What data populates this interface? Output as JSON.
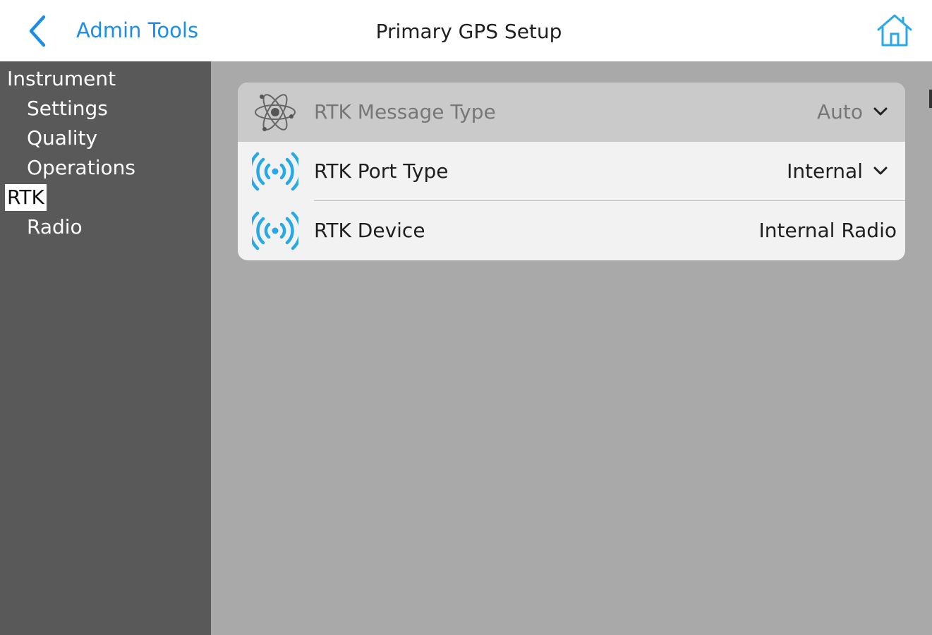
{
  "header": {
    "back_label": "Admin Tools",
    "title": "Primary GPS Setup",
    "back_icon": "chevron-left-icon",
    "home_icon": "home-icon"
  },
  "sidebar": {
    "items": [
      {
        "label": "Instrument",
        "level": 0,
        "selected": false
      },
      {
        "label": "Settings",
        "level": 1,
        "selected": false
      },
      {
        "label": "Quality",
        "level": 1,
        "selected": false
      },
      {
        "label": "Operations",
        "level": 1,
        "selected": false
      },
      {
        "label": "RTK",
        "level": 0,
        "selected": true
      },
      {
        "label": "Radio",
        "level": 1,
        "selected": false
      }
    ]
  },
  "settings": {
    "rows": [
      {
        "label": "RTK Message Type",
        "value": "Auto",
        "icon": "atom-icon",
        "dropdown": true,
        "disabled": true
      },
      {
        "label": "RTK Port Type",
        "value": "Internal",
        "icon": "radio-signal-icon",
        "dropdown": true,
        "disabled": false
      },
      {
        "label": "RTK Device",
        "value": "Internal Radio",
        "icon": "radio-signal-icon",
        "dropdown": false,
        "disabled": false
      }
    ]
  },
  "colors": {
    "accent": "#1c8ee8",
    "sidebar_bg": "#595959",
    "content_bg": "#a9a9a9",
    "card_bg": "#f2f2f2",
    "disabled_row_bg": "#cacaca",
    "signal_icon": "#29a8e6"
  }
}
